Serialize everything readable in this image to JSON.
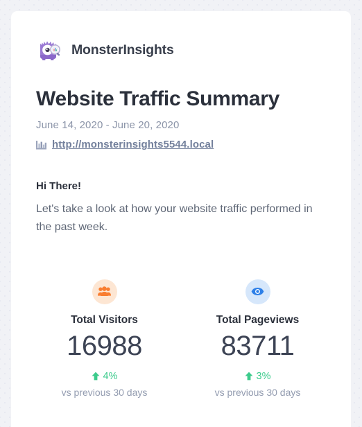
{
  "brand": {
    "name": "MonsterInsights",
    "logo_icon": "monsterinsights-monster-logo"
  },
  "header": {
    "title": "Website Traffic Summary",
    "date_range": "June 14, 2020 - June 20, 2020",
    "site_url": "http://monsterinsights5544.local",
    "site_icon": "bar-chart-icon"
  },
  "body": {
    "greeting": "Hi There!",
    "intro": "Let's take a look at how your website traffic performed in the past week."
  },
  "stats": [
    {
      "icon": "users-group-icon",
      "icon_bg": "#fde6d3",
      "icon_color": "#f97d30",
      "label": "Total Visitors",
      "value": "16988",
      "delta": "4%",
      "delta_direction": "up",
      "delta_color": "#3ccb8c",
      "compare": "vs previous 30 days"
    },
    {
      "icon": "eye-icon",
      "icon_bg": "#d6e7fb",
      "icon_color": "#2e80e8",
      "label": "Total Pageviews",
      "value": "83711",
      "delta": "3%",
      "delta_direction": "up",
      "delta_color": "#3ccb8c",
      "compare": "vs previous 30 days"
    }
  ],
  "colors": {
    "page_background": "#f1f2f6",
    "card_background": "#ffffff",
    "title_text": "#2b303b",
    "muted_text": "#8b94a8",
    "link": "#73809c",
    "accent_green": "#3ccb8c",
    "brand_purple": "#9a79d4"
  }
}
